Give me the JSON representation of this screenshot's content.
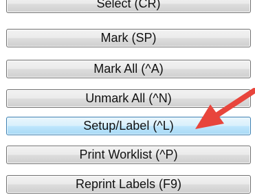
{
  "buttons": [
    {
      "label": "Select (CR)"
    },
    {
      "label": "Mark (SP)"
    },
    {
      "label": "Mark All (^A)"
    },
    {
      "label": "Unmark All (^N)"
    },
    {
      "label": "Setup/Label (^L)",
      "highlighted": true
    },
    {
      "label": "Print Worklist (^P)"
    },
    {
      "label": "Reprint Labels (F9)"
    }
  ],
  "annotation": {
    "icon": "arrow-icon",
    "color": "#e8453c"
  }
}
